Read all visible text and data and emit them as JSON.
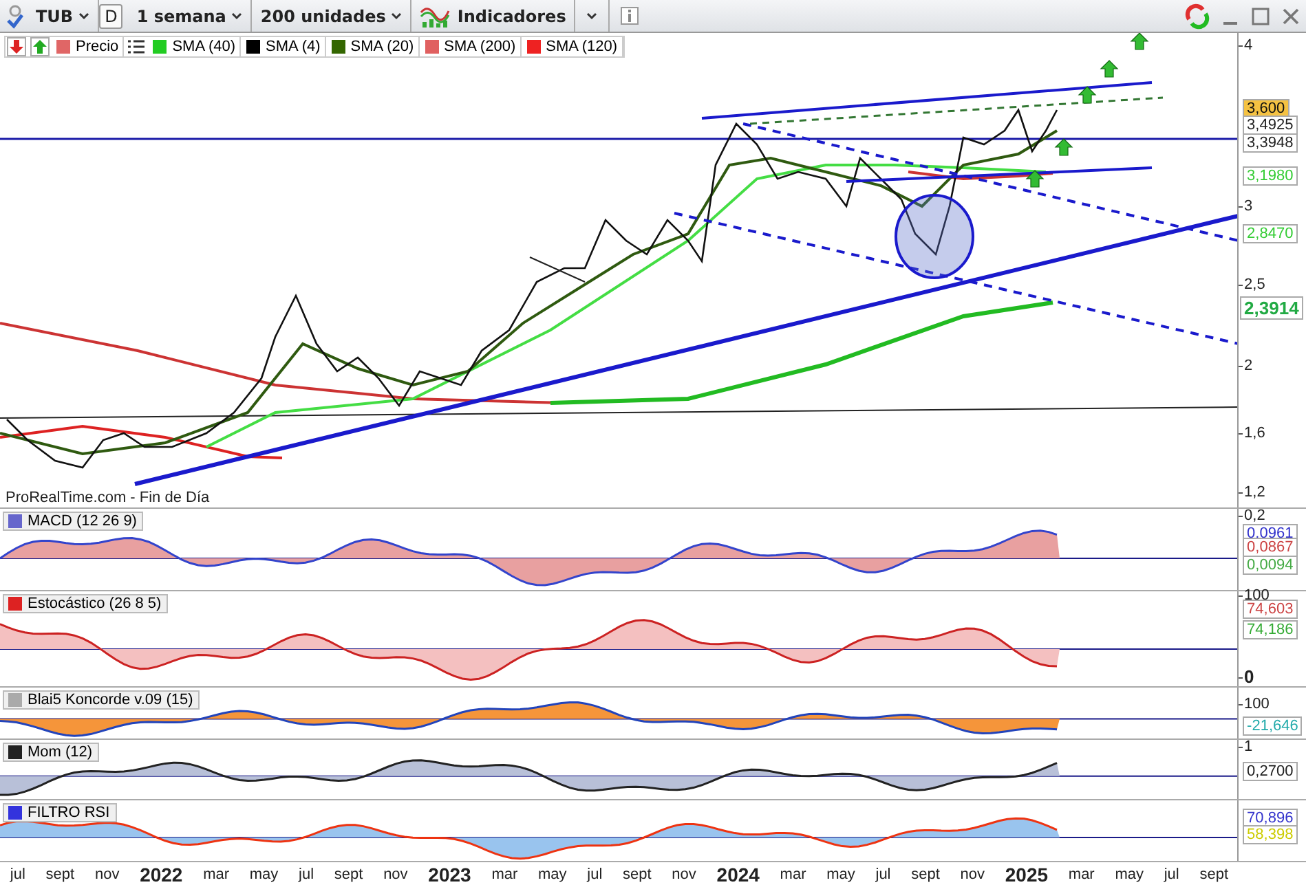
{
  "toolbar": {
    "symbol": "TUB",
    "period_button": "D",
    "timeframe": "1 semana",
    "units": "200 unidades",
    "indicators": "Indicadores"
  },
  "legend": [
    {
      "label": "Precio",
      "color": "#e06666"
    },
    {
      "label": "SMA (40)",
      "color": "#22cc22"
    },
    {
      "label": "SMA (4)",
      "color": "#000000"
    },
    {
      "label": "SMA (20)",
      "color": "#336600"
    },
    {
      "label": "SMA (200)",
      "color": "#e06060"
    },
    {
      "label": "SMA (120)",
      "color": "#ee2222"
    }
  ],
  "main_chart": {
    "source": "ProRealTime.com - Fin de Día",
    "y_ticks": [
      "4",
      "3",
      "2,5",
      "2",
      "1,6",
      "1,2"
    ],
    "price_tags": [
      {
        "label": "3,600",
        "kind": "last"
      },
      {
        "label": "3,4925",
        "kind": "plain"
      },
      {
        "label": "3,3948",
        "kind": "plain"
      },
      {
        "label": "3,1980",
        "kind": "green"
      },
      {
        "label": "2,8470",
        "kind": "green"
      },
      {
        "label": "2,3914",
        "kind": "bold"
      }
    ]
  },
  "panels": [
    {
      "title": "MACD (12 26 9)",
      "color": "#6666cc",
      "ticks": [
        "0,2"
      ],
      "tags": [
        {
          "label": "0,0961",
          "color": "#3333cc"
        },
        {
          "label": "0,0867",
          "color": "#cc4444"
        },
        {
          "label": "0,0094",
          "color": "#44aa44"
        }
      ]
    },
    {
      "title": "Estocástico (26 8 5)",
      "color": "#dd2222",
      "ticks": [
        "100",
        "0"
      ],
      "tags": [
        {
          "label": "74,603",
          "color": "#cc4444"
        },
        {
          "label": "74,186",
          "color": "#33aa33"
        }
      ]
    },
    {
      "title": "Blai5 Koncorde v.09 (15)",
      "color": "#aaaaaa",
      "ticks": [
        "100"
      ],
      "tags": [
        {
          "label": "-21,646",
          "color": "#22aaaa"
        }
      ]
    },
    {
      "title": "Mom (12)",
      "color": "#222222",
      "ticks": [
        "1"
      ],
      "tags": [
        {
          "label": "0,2700",
          "color": "#222222"
        }
      ]
    },
    {
      "title": "FILTRO RSI",
      "color": "#3333dd",
      "tags": [
        {
          "label": "70,896",
          "color": "#3333cc"
        },
        {
          "label": "58,398",
          "color": "#cccc00"
        }
      ]
    }
  ],
  "x_axis": [
    {
      "label": "jul",
      "kind": "month"
    },
    {
      "label": "sept",
      "kind": "month"
    },
    {
      "label": "nov",
      "kind": "month"
    },
    {
      "label": "2022",
      "kind": "year"
    },
    {
      "label": "mar",
      "kind": "month"
    },
    {
      "label": "may",
      "kind": "month"
    },
    {
      "label": "jul",
      "kind": "month"
    },
    {
      "label": "sept",
      "kind": "month"
    },
    {
      "label": "nov",
      "kind": "month"
    },
    {
      "label": "2023",
      "kind": "year"
    },
    {
      "label": "mar",
      "kind": "month"
    },
    {
      "label": "may",
      "kind": "month"
    },
    {
      "label": "jul",
      "kind": "month"
    },
    {
      "label": "sept",
      "kind": "month"
    },
    {
      "label": "nov",
      "kind": "month"
    },
    {
      "label": "2024",
      "kind": "year"
    },
    {
      "label": "mar",
      "kind": "month"
    },
    {
      "label": "may",
      "kind": "month"
    },
    {
      "label": "jul",
      "kind": "month"
    },
    {
      "label": "sept",
      "kind": "month"
    },
    {
      "label": "nov",
      "kind": "month"
    },
    {
      "label": "2025",
      "kind": "year"
    },
    {
      "label": "mar",
      "kind": "month"
    },
    {
      "label": "may",
      "kind": "month"
    },
    {
      "label": "jul",
      "kind": "month"
    },
    {
      "label": "sept",
      "kind": "month"
    }
  ]
}
